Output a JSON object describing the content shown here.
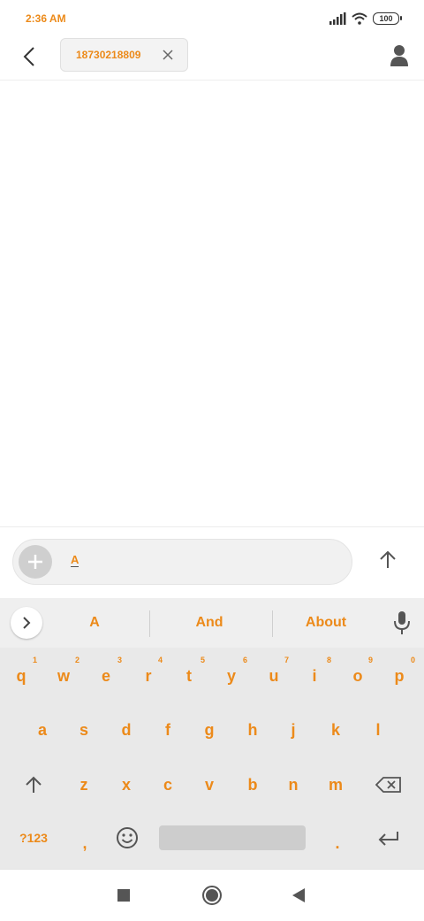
{
  "status_bar": {
    "time": "2:36 AM",
    "battery": "100"
  },
  "header": {
    "recipient": "18730218809"
  },
  "compose": {
    "text": "A"
  },
  "keyboard": {
    "suggestions": [
      "A",
      "And",
      "About"
    ],
    "row1": [
      {
        "key": "q",
        "hint": "1"
      },
      {
        "key": "w",
        "hint": "2"
      },
      {
        "key": "e",
        "hint": "3"
      },
      {
        "key": "r",
        "hint": "4"
      },
      {
        "key": "t",
        "hint": "5"
      },
      {
        "key": "y",
        "hint": "6"
      },
      {
        "key": "u",
        "hint": "7"
      },
      {
        "key": "i",
        "hint": "8"
      },
      {
        "key": "o",
        "hint": "9"
      },
      {
        "key": "p",
        "hint": "0"
      }
    ],
    "row2": [
      "a",
      "s",
      "d",
      "f",
      "g",
      "h",
      "j",
      "k",
      "l"
    ],
    "row3": [
      "z",
      "x",
      "c",
      "v",
      "b",
      "n",
      "m"
    ],
    "symbols_label": "?123",
    "comma": ",",
    "period": "."
  },
  "colors": {
    "accent": "#ec8a1a",
    "keyboard_bg": "#e9e9e9",
    "icon_gray": "#555555"
  }
}
